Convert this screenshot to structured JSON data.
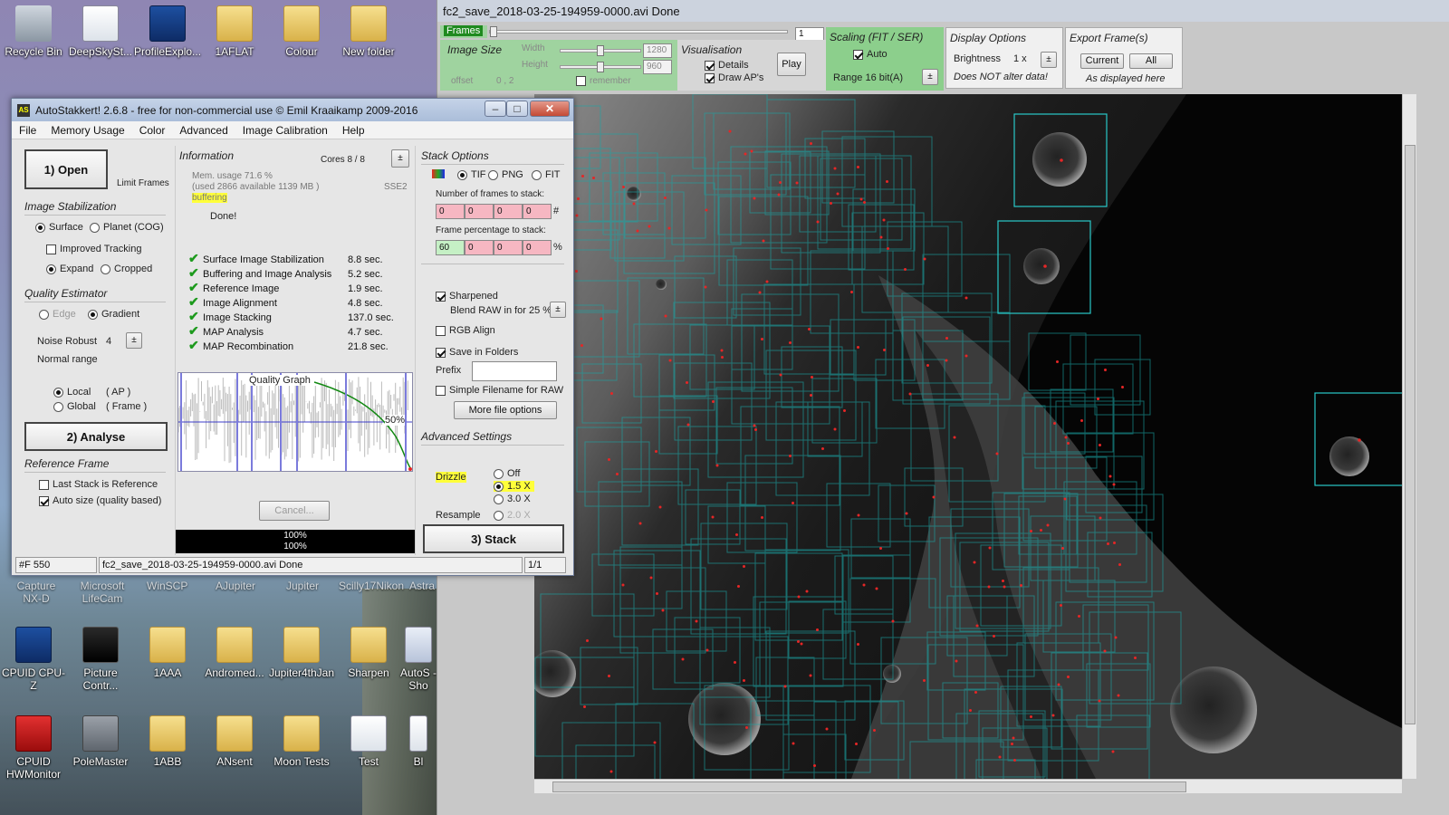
{
  "desktop": {
    "icons_row1": [
      "Recycle Bin",
      "DeepSkySt...",
      "ProfileExplo...",
      "1AFLAT",
      "Colour",
      "New folder"
    ],
    "icons_row2": [
      "Capture NX-D",
      "Microsoft LifeCam",
      "WinSCP",
      "AJupiter",
      "Jupiter",
      "Scilly17Nikon",
      "Astra"
    ],
    "icons_row3": [
      "CPUID CPU-Z",
      "Picture Contr...",
      "1AAA",
      "Andromed...",
      "Jupiter4thJan",
      "Sharpen",
      "AutoS - Sho"
    ],
    "icons_row4": [
      "CPUID HWMonitor",
      "PoleMaster",
      "1ABB",
      "ANsent",
      "Moon Tests",
      "Test",
      "Bl"
    ]
  },
  "fc": {
    "title": "fc2_save_2018-03-25-194959-0000.avi   Done",
    "frames_label": "Frames",
    "frame_value": "1",
    "image_size": "Image Size",
    "width_label": "Width",
    "height_label": "Height",
    "width_value": "1280",
    "height_value": "960",
    "offset_label": "offset",
    "offset_value": "0 , 2",
    "remember_label": "remember",
    "visualisation": "Visualisation",
    "details_label": "Details",
    "draw_aps_label": "Draw AP's",
    "play_button": "Play",
    "scaling": "Scaling (FIT / SER)",
    "auto_label": "Auto",
    "range_label": "Range 16 bit(A)",
    "display_options": "Display Options",
    "brightness_label": "Brightness",
    "brightness_value": "1 x",
    "not_alter": "Does NOT alter data!",
    "export_frames": "Export Frame(s)",
    "current_button": "Current",
    "all_button": "All",
    "as_displayed": "As displayed here"
  },
  "as": {
    "title": "AutoStakkert! 2.6.8 - free for non-commercial use © Emil Kraaikamp 2009-2016",
    "menu": [
      "File",
      "Memory Usage",
      "Color",
      "Advanced",
      "Image Calibration",
      "Help"
    ],
    "open_button": "1) Open",
    "limit_frames": "Limit Frames",
    "image_stabilization": "Image Stabilization",
    "surface": "Surface",
    "planet": "Planet (COG)",
    "improved_tracking": "Improved Tracking",
    "expand": "Expand",
    "cropped": "Cropped",
    "quality_estimator": "Quality Estimator",
    "edge": "Edge",
    "gradient": "Gradient",
    "noise_robust": "Noise Robust",
    "noise_value": "4",
    "normal_range": "Normal range",
    "local": "Local",
    "local_ap": "( AP )",
    "global": "Global",
    "global_frame": "( Frame )",
    "analyse_button": "2) Analyse",
    "reference_frame": "Reference Frame",
    "last_stack": "Last Stack is Reference",
    "auto_size": "Auto size (quality based)",
    "information": "Information",
    "cores": "Cores 8 / 8",
    "mem_usage": "Mem. usage 71.6 %",
    "mem_detail": "(used 2866 available 1139 MB )",
    "sse": "SSE2",
    "buffering": "buffering",
    "done": "Done!",
    "timings": [
      {
        "name": "Surface Image Stabilization",
        "time": "8.8 sec."
      },
      {
        "name": "Buffering and Image Analysis",
        "time": "5.2 sec."
      },
      {
        "name": "Reference Image",
        "time": "1.9 sec."
      },
      {
        "name": "Image Alignment",
        "time": "4.8 sec."
      },
      {
        "name": "Image Stacking",
        "time": "137.0 sec."
      },
      {
        "name": "MAP Analysis",
        "time": "4.7 sec."
      },
      {
        "name": "MAP Recombination",
        "time": "21.8 sec."
      }
    ],
    "quality_graph": "Quality Graph",
    "graph_percent": "50%",
    "cancel_button": "Cancel...",
    "progress1": "100%",
    "progress2": "100%",
    "stack_options": "Stack Options",
    "tif": "TIF",
    "png": "PNG",
    "fit": "FIT",
    "num_frames_label": "Number of frames to stack:",
    "num_frames": [
      "0",
      "0",
      "0",
      "0"
    ],
    "hash": "#",
    "frame_pct_label": "Frame percentage to stack:",
    "frame_pct": [
      "60",
      "0",
      "0",
      "0"
    ],
    "pct": "%",
    "sharpened": "Sharpened",
    "blend_raw": "Blend RAW in for 25 %",
    "rgb_align": "RGB Align",
    "save_folders": "Save in Folders",
    "prefix": "Prefix",
    "simple_filename": "Simple Filename for RAW",
    "more_file_options": "More file options",
    "advanced_settings": "Advanced Settings",
    "drizzle": "Drizzle",
    "drizzle_off": "Off",
    "drizzle_15": "1.5 X",
    "drizzle_30": "3.0 X",
    "resample": "Resample",
    "resample_20": "2.0 X",
    "stack_button": "3) Stack",
    "status_frames": "#F 550",
    "status_file": "fc2_save_2018-03-25-194959-0000.avi   Done",
    "status_page": "1/1"
  },
  "colors": {
    "accent_green": "#9fd39f",
    "ap_box": "#1aa6a6",
    "highlight": "#ffff3a"
  }
}
